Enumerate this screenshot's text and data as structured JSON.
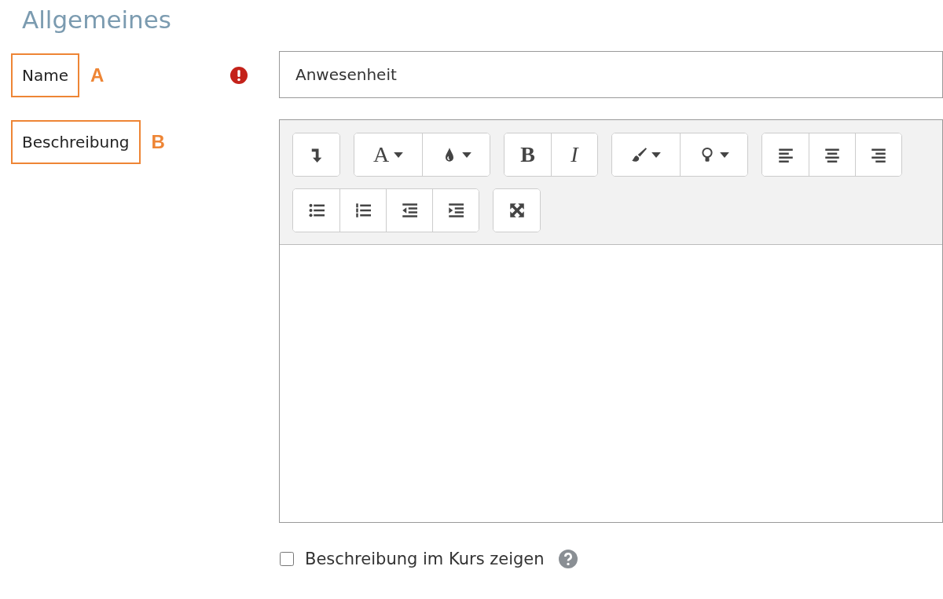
{
  "section_title": "Allgemeines",
  "name_field": {
    "label": "Name",
    "annotation": "A",
    "required": true,
    "value": "Anwesenheit"
  },
  "description_field": {
    "label": "Beschreibung",
    "annotation": "B",
    "toolbar_rows": [
      [
        {
          "buttons": [
            {
              "kind": "icon",
              "dropdown": false
            }
          ]
        },
        {
          "buttons": [
            {
              "kind": "glyph",
              "label": "A",
              "dropdown": true
            },
            {
              "kind": "icon",
              "dropdown": true
            }
          ]
        },
        {
          "buttons": [
            {
              "kind": "glyph",
              "label": "B",
              "dropdown": false
            },
            {
              "kind": "glyph",
              "label": "I",
              "dropdown": false
            }
          ]
        },
        {
          "buttons": [
            {
              "kind": "icon",
              "dropdown": true
            },
            {
              "kind": "icon",
              "dropdown": true
            }
          ]
        },
        {
          "buttons": [
            {
              "kind": "icon",
              "dropdown": false
            },
            {
              "kind": "icon",
              "dropdown": false
            },
            {
              "kind": "icon",
              "dropdown": false
            }
          ]
        }
      ],
      [
        {
          "buttons": [
            {
              "kind": "icon",
              "dropdown": false
            },
            {
              "kind": "icon",
              "dropdown": false
            },
            {
              "kind": "icon",
              "dropdown": false
            },
            {
              "kind": "icon",
              "dropdown": false
            }
          ]
        },
        {
          "buttons": [
            {
              "kind": "icon",
              "dropdown": false
            }
          ]
        }
      ]
    ]
  },
  "show_in_course": {
    "label": "Beschreibung im Kurs zeigen",
    "checked": false
  }
}
